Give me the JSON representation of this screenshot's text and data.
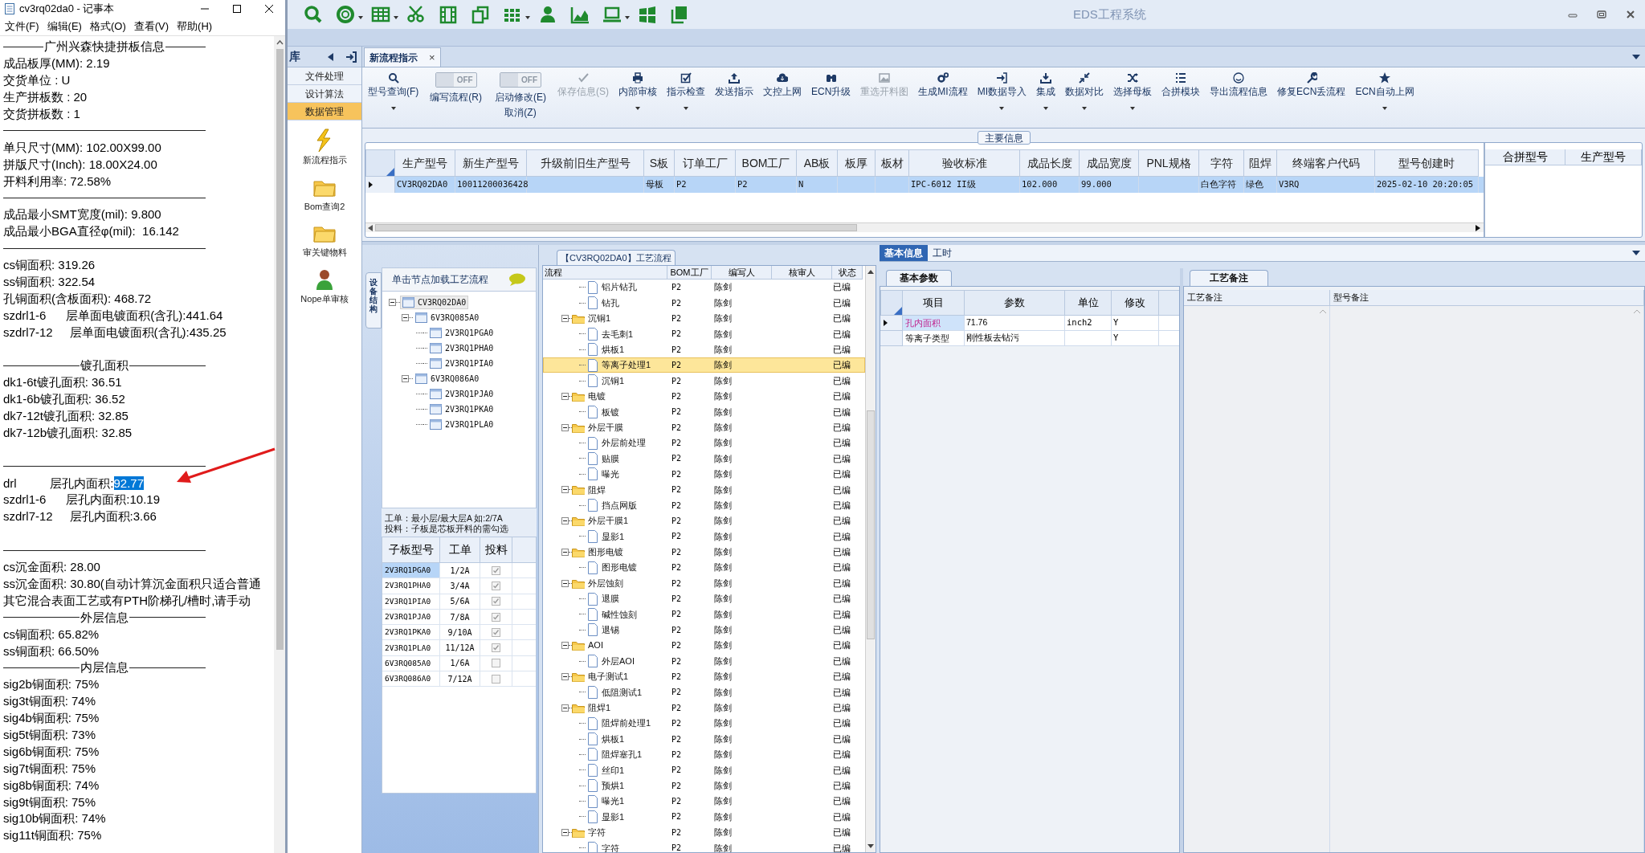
{
  "notepad": {
    "title": "cv3rq02da0 - 记事本",
    "menu": [
      "文件(F)",
      "编辑(E)",
      "格式(O)",
      "查看(V)",
      "帮助(H)"
    ],
    "lines": [
      {
        "kind": "heading",
        "text": "广州兴森快捷拼板信息"
      },
      {
        "kind": "text",
        "text": "成品板厚(MM): 2.19"
      },
      {
        "kind": "text",
        "text": "交货单位 : U"
      },
      {
        "kind": "text",
        "text": "生产拼板数 : 20"
      },
      {
        "kind": "text",
        "text": "交货拼板数 : 1"
      },
      {
        "kind": "rule"
      },
      {
        "kind": "text",
        "text": "单只尺寸(MM): 102.00X99.00"
      },
      {
        "kind": "text",
        "text": "拼版尺寸(Inch): 18.00X24.00"
      },
      {
        "kind": "text",
        "text": "开料利用率: 72.58%"
      },
      {
        "kind": "rule"
      },
      {
        "kind": "text",
        "text": "成品最小SMT宽度(mil): 9.800"
      },
      {
        "kind": "text",
        "text": "成品最小BGA直径φ(mil):  16.142"
      },
      {
        "kind": "rule"
      },
      {
        "kind": "text",
        "text": "cs铜面积: 319.26"
      },
      {
        "kind": "text",
        "text": "ss铜面积: 322.54"
      },
      {
        "kind": "text",
        "text": "孔铜面积(含板面积): 468.72"
      },
      {
        "kind": "text",
        "text": "szdrl1-6      层单面电镀面积(含孔):441.64"
      },
      {
        "kind": "text",
        "text": "szdrl7-12     层单面电镀面积(含孔):435.25"
      },
      {
        "kind": "blank"
      },
      {
        "kind": "heading",
        "text": "镀孔面积"
      },
      {
        "kind": "text",
        "text": "dk1-6t镀孔面积: 36.51"
      },
      {
        "kind": "text",
        "text": "dk1-6b镀孔面积: 36.52"
      },
      {
        "kind": "text",
        "text": "dk7-12t镀孔面积: 32.85"
      },
      {
        "kind": "text",
        "text": "dk7-12b镀孔面积: 32.85"
      },
      {
        "kind": "blank"
      },
      {
        "kind": "rule"
      },
      {
        "kind": "text",
        "text": "drl          层孔内面积:",
        "selection": "92.77"
      },
      {
        "kind": "text",
        "text": "szdrl1-6      层孔内面积:10.19"
      },
      {
        "kind": "text",
        "text": "szdrl7-12     层孔内面积:3.66"
      },
      {
        "kind": "blank"
      },
      {
        "kind": "rule"
      },
      {
        "kind": "text",
        "text": "cs沉金面积: 28.00"
      },
      {
        "kind": "text",
        "text": "ss沉金面积: 30.80(自动计算沉金面积只适合普通"
      },
      {
        "kind": "text",
        "text": "其它混合表面工艺或有PTH阶梯孔/槽时,请手动"
      },
      {
        "kind": "heading",
        "text": "外层信息"
      },
      {
        "kind": "text",
        "text": "cs铜面积: 65.82%"
      },
      {
        "kind": "text",
        "text": "ss铜面积: 66.50%"
      },
      {
        "kind": "heading",
        "text": "内层信息"
      },
      {
        "kind": "text",
        "text": "sig2b铜面积: 75%"
      },
      {
        "kind": "text",
        "text": "sig3t铜面积: 74%"
      },
      {
        "kind": "text",
        "text": "sig4b铜面积: 75%"
      },
      {
        "kind": "text",
        "text": "sig5t铜面积: 73%"
      },
      {
        "kind": "text",
        "text": "sig6b铜面积: 75%"
      },
      {
        "kind": "text",
        "text": "sig7t铜面积: 75%"
      },
      {
        "kind": "text",
        "text": "sig8b铜面积: 74%"
      },
      {
        "kind": "text",
        "text": "sig9t铜面积: 75%"
      },
      {
        "kind": "text",
        "text": "sig10b铜面积: 74%"
      },
      {
        "kind": "text",
        "text": "sig11t铜面积: 75%"
      }
    ]
  },
  "app": {
    "title": "EDS工程系统",
    "sidebar": {
      "title": "库",
      "nav": [
        {
          "label": "文件处理",
          "selected": false
        },
        {
          "label": "设计算法",
          "selected": false
        },
        {
          "label": "数据管理",
          "selected": true
        }
      ],
      "shortcuts": [
        {
          "label": "新流程指示"
        },
        {
          "label": "Bom查询2"
        },
        {
          "label": "审关键物料"
        },
        {
          "label": "Nope单审核"
        }
      ]
    },
    "tab": {
      "label": "新流程指示",
      "close": "×",
      "selected": true
    },
    "ribbon": [
      {
        "kind": "button",
        "label": "型号查询(F)",
        "disabled": false,
        "has_menu": true
      },
      {
        "kind": "toggle",
        "label": "编写流程(R)",
        "switch_text": "OFF",
        "on": false
      },
      {
        "kind": "toggle",
        "label": "启动修改(E)",
        "sublabel": "取消(Z)",
        "switch_text": "OFF",
        "on": false
      },
      {
        "kind": "button",
        "label": "保存信息(S)",
        "disabled": true,
        "has_menu": false
      },
      {
        "kind": "button",
        "label": "内部审核",
        "disabled": false,
        "has_menu": true
      },
      {
        "kind": "button",
        "label": "指示检查",
        "disabled": false,
        "has_menu": true
      },
      {
        "kind": "button",
        "label": "发送指示",
        "disabled": false,
        "has_menu": false
      },
      {
        "kind": "button",
        "label": "文控上网",
        "disabled": false,
        "has_menu": false
      },
      {
        "kind": "button",
        "label": "ECN升级",
        "disabled": false,
        "has_menu": false
      },
      {
        "kind": "button",
        "label": "重选开料图",
        "disabled": true,
        "has_menu": false
      },
      {
        "kind": "button",
        "label": "生成MI流程",
        "disabled": false,
        "has_menu": false
      },
      {
        "kind": "button",
        "label": "MI数据导入",
        "disabled": false,
        "has_menu": true
      },
      {
        "kind": "button",
        "label": "集成",
        "disabled": false,
        "has_menu": true
      },
      {
        "kind": "button",
        "label": "数据对比",
        "disabled": false,
        "has_menu": true
      },
      {
        "kind": "button",
        "label": "选择母板",
        "disabled": false,
        "has_menu": true
      },
      {
        "kind": "button",
        "label": "合拼模块",
        "disabled": false,
        "has_menu": false
      },
      {
        "kind": "button",
        "label": "导出流程信息",
        "disabled": false,
        "has_menu": false
      },
      {
        "kind": "button",
        "label": "修复ECN丢流程",
        "disabled": false,
        "has_menu": false
      },
      {
        "kind": "button",
        "label": "ECN自动上网",
        "disabled": false,
        "has_menu": true
      }
    ],
    "main_info": {
      "title": "主要信息",
      "columns": [
        "生产型号",
        "新生产型号",
        "升级前旧生产型号",
        "S板",
        "订单工厂",
        "BOM工厂",
        "AB板",
        "板厚",
        "板材",
        "验收标准",
        "成品长度",
        "成品宽度",
        "PNL规格",
        "字符",
        "阻焊",
        "终端客户代码",
        "型号创建时"
      ],
      "rows": [
        {
          "selected": true,
          "cells": [
            "CV3RQ02DA0",
            "10011200036428",
            null,
            "母板",
            "P2",
            "P2",
            "N",
            null,
            null,
            "IPC-6012 II级",
            "102.000",
            "99.000",
            null,
            "白色字符",
            "绿色",
            "V3RQ",
            "2025-02-10 20:20:05"
          ]
        }
      ],
      "merge_columns": [
        "合拼型号",
        "生产型号"
      ]
    },
    "structure": {
      "tab": "设备结构",
      "header": "单击节点加载工艺流程",
      "tree": [
        {
          "label": "CV3RQ02DA0",
          "selected": true,
          "expanded": true,
          "children": [
            {
              "label": "6V3RQ085A0",
              "selected": false,
              "expanded": true,
              "children": [
                {
                  "label": "2V3RQ1PGA0",
                  "selected": false
                },
                {
                  "label": "2V3RQ1PHA0",
                  "selected": false
                },
                {
                  "label": "2V3RQ1PIA0",
                  "selected": false
                }
              ]
            },
            {
              "label": "6V3RQ086A0",
              "selected": false,
              "expanded": true,
              "children": [
                {
                  "label": "2V3RQ1PJA0",
                  "selected": false
                },
                {
                  "label": "2V3RQ1PKA0",
                  "selected": false
                },
                {
                  "label": "2V3RQ1PLA0",
                  "selected": false
                }
              ]
            }
          ]
        }
      ],
      "notes": [
        "工单：最小层/最大层A 如:2/7A",
        "投料：子板是芯板开料的需勾选"
      ],
      "columns": [
        "子板型号",
        "工单",
        "投料"
      ],
      "rows": [
        {
          "model": "2V3RQ1PGA0",
          "order": "1/2A",
          "fed": true,
          "selected": true
        },
        {
          "model": "2V3RQ1PHA0",
          "order": "3/4A",
          "fed": true,
          "selected": false
        },
        {
          "model": "2V3RQ1PIA0",
          "order": "5/6A",
          "fed": true,
          "selected": false
        },
        {
          "model": "2V3RQ1PJA0",
          "order": "7/8A",
          "fed": true,
          "selected": false
        },
        {
          "model": "2V3RQ1PKA0",
          "order": "9/10A",
          "fed": true,
          "selected": false
        },
        {
          "model": "2V3RQ1PLA0",
          "order": "11/12A",
          "fed": true,
          "selected": false
        },
        {
          "model": "6V3RQ085A0",
          "order": "1/6A",
          "fed": false,
          "selected": false
        },
        {
          "model": "6V3RQ086A0",
          "order": "7/12A",
          "fed": false,
          "selected": false
        }
      ]
    },
    "flow": {
      "title": "【CV3RQ02DA0】工艺流程",
      "columns": [
        "流程",
        "BOM工厂",
        "编写人",
        "核审人",
        "状态"
      ],
      "rows": [
        {
          "kind": "step",
          "name": "铝片钻孔",
          "bom": "P2",
          "writer": "陈剑",
          "status": "已编",
          "selected": false
        },
        {
          "kind": "step",
          "name": "钻孔",
          "bom": "P2",
          "writer": "陈剑",
          "status": "已编",
          "selected": false
        },
        {
          "kind": "folder",
          "name": "沉铜1",
          "bom": "P2",
          "writer": "陈剑",
          "status": "已编",
          "selected": false,
          "expanded": true,
          "children": [
            {
              "kind": "step",
              "name": "去毛刺1",
              "bom": "P2",
              "writer": "陈剑",
              "status": "已编",
              "selected": false
            },
            {
              "kind": "step",
              "name": "烘板1",
              "bom": "P2",
              "writer": "陈剑",
              "status": "已编",
              "selected": false
            },
            {
              "kind": "step",
              "name": "等离子处理1",
              "bom": "P2",
              "writer": "陈剑",
              "status": "已编",
              "selected": true
            },
            {
              "kind": "step",
              "name": "沉铜1",
              "bom": "P2",
              "writer": "陈剑",
              "status": "已编",
              "selected": false
            }
          ]
        },
        {
          "kind": "folder",
          "name": "电镀",
          "bom": "P2",
          "writer": "陈剑",
          "status": "已编",
          "selected": false,
          "expanded": true,
          "children": [
            {
              "kind": "step",
              "name": "板镀",
              "bom": "P2",
              "writer": "陈剑",
              "status": "已编",
              "selected": false
            }
          ]
        },
        {
          "kind": "folder",
          "name": "外层干膜",
          "bom": "P2",
          "writer": "陈剑",
          "status": "已编",
          "selected": false,
          "expanded": true,
          "children": [
            {
              "kind": "step",
              "name": "外层前处理",
              "bom": "P2",
              "writer": "陈剑",
              "status": "已编",
              "selected": false
            },
            {
              "kind": "step",
              "name": "贴膜",
              "bom": "P2",
              "writer": "陈剑",
              "status": "已编",
              "selected": false
            },
            {
              "kind": "step",
              "name": "曝光",
              "bom": "P2",
              "writer": "陈剑",
              "status": "已编",
              "selected": false
            }
          ]
        },
        {
          "kind": "folder",
          "name": "阻焊",
          "bom": "P2",
          "writer": "陈剑",
          "status": "已编",
          "selected": false,
          "expanded": true,
          "children": [
            {
              "kind": "step",
              "name": "挡点网版",
              "bom": "P2",
              "writer": "陈剑",
              "status": "已编",
              "selected": false
            }
          ]
        },
        {
          "kind": "folder",
          "name": "外层干膜1",
          "bom": "P2",
          "writer": "陈剑",
          "status": "已编",
          "selected": false,
          "expanded": true,
          "children": [
            {
              "kind": "step",
              "name": "显影1",
              "bom": "P2",
              "writer": "陈剑",
              "status": "已编",
              "selected": false
            }
          ]
        },
        {
          "kind": "folder",
          "name": "图形电镀",
          "bom": "P2",
          "writer": "陈剑",
          "status": "已编",
          "selected": false,
          "expanded": true,
          "children": [
            {
              "kind": "step",
              "name": "图形电镀",
              "bom": "P2",
              "writer": "陈剑",
              "status": "已编",
              "selected": false
            }
          ]
        },
        {
          "kind": "folder",
          "name": "外层蚀刻",
          "bom": "P2",
          "writer": "陈剑",
          "status": "已编",
          "selected": false,
          "expanded": true,
          "children": [
            {
              "kind": "step",
              "name": "退膜",
              "bom": "P2",
              "writer": "陈剑",
              "status": "已编",
              "selected": false
            },
            {
              "kind": "step",
              "name": "碱性蚀刻",
              "bom": "P2",
              "writer": "陈剑",
              "status": "已编",
              "selected": false
            },
            {
              "kind": "step",
              "name": "退锡",
              "bom": "P2",
              "writer": "陈剑",
              "status": "已编",
              "selected": false
            }
          ]
        },
        {
          "kind": "folder",
          "name": "AOI",
          "bom": "P2",
          "writer": "陈剑",
          "status": "已编",
          "selected": false,
          "expanded": true,
          "children": [
            {
              "kind": "step",
              "name": "外层AOI",
              "bom": "P2",
              "writer": "陈剑",
              "status": "已编",
              "selected": false
            }
          ]
        },
        {
          "kind": "folder",
          "name": "电子测试1",
          "bom": "P2",
          "writer": "陈剑",
          "status": "已编",
          "selected": false,
          "expanded": true,
          "children": [
            {
              "kind": "step",
              "name": "低阻测试1",
              "bom": "P2",
              "writer": "陈剑",
              "status": "已编",
              "selected": false
            }
          ]
        },
        {
          "kind": "folder",
          "name": "阻焊1",
          "bom": "P2",
          "writer": "陈剑",
          "status": "已编",
          "selected": false,
          "expanded": true,
          "children": [
            {
              "kind": "step",
              "name": "阻焊前处理1",
              "bom": "P2",
              "writer": "陈剑",
              "status": "已编",
              "selected": false
            },
            {
              "kind": "step",
              "name": "烘板1",
              "bom": "P2",
              "writer": "陈剑",
              "status": "已编",
              "selected": false
            },
            {
              "kind": "step",
              "name": "阻焊塞孔1",
              "bom": "P2",
              "writer": "陈剑",
              "status": "已编",
              "selected": false
            },
            {
              "kind": "step",
              "name": "丝印1",
              "bom": "P2",
              "writer": "陈剑",
              "status": "已编",
              "selected": false
            },
            {
              "kind": "step",
              "name": "预烘1",
              "bom": "P2",
              "writer": "陈剑",
              "status": "已编",
              "selected": false
            },
            {
              "kind": "step",
              "name": "曝光1",
              "bom": "P2",
              "writer": "陈剑",
              "status": "已编",
              "selected": false
            },
            {
              "kind": "step",
              "name": "显影1",
              "bom": "P2",
              "writer": "陈剑",
              "status": "已编",
              "selected": false
            }
          ]
        },
        {
          "kind": "folder",
          "name": "字符",
          "bom": "P2",
          "writer": "陈剑",
          "status": "已编",
          "selected": false,
          "expanded": true,
          "children": [
            {
              "kind": "step",
              "name": "字符",
              "bom": "P2",
              "writer": "陈剑",
              "status": "已编",
              "selected": false
            }
          ]
        }
      ]
    },
    "details": {
      "tabs": [
        {
          "label": "基本信息",
          "selected": true
        },
        {
          "label": "工时",
          "selected": false
        }
      ],
      "params": {
        "tab": "基本参数",
        "columns": [
          "项目",
          "参数",
          "单位",
          "修改"
        ],
        "rows": [
          {
            "item": "孔内面积",
            "value": "71.76",
            "unit": "inch2",
            "modified": "Y",
            "selected": true,
            "highlighted": true
          },
          {
            "item": "等离子类型",
            "value": "刚性板去钻污",
            "unit": null,
            "modified": "Y",
            "selected": false,
            "highlighted": false
          }
        ]
      },
      "remarks": {
        "tab": "工艺备注",
        "columns": [
          "工艺备注",
          "型号备注"
        ]
      }
    }
  }
}
